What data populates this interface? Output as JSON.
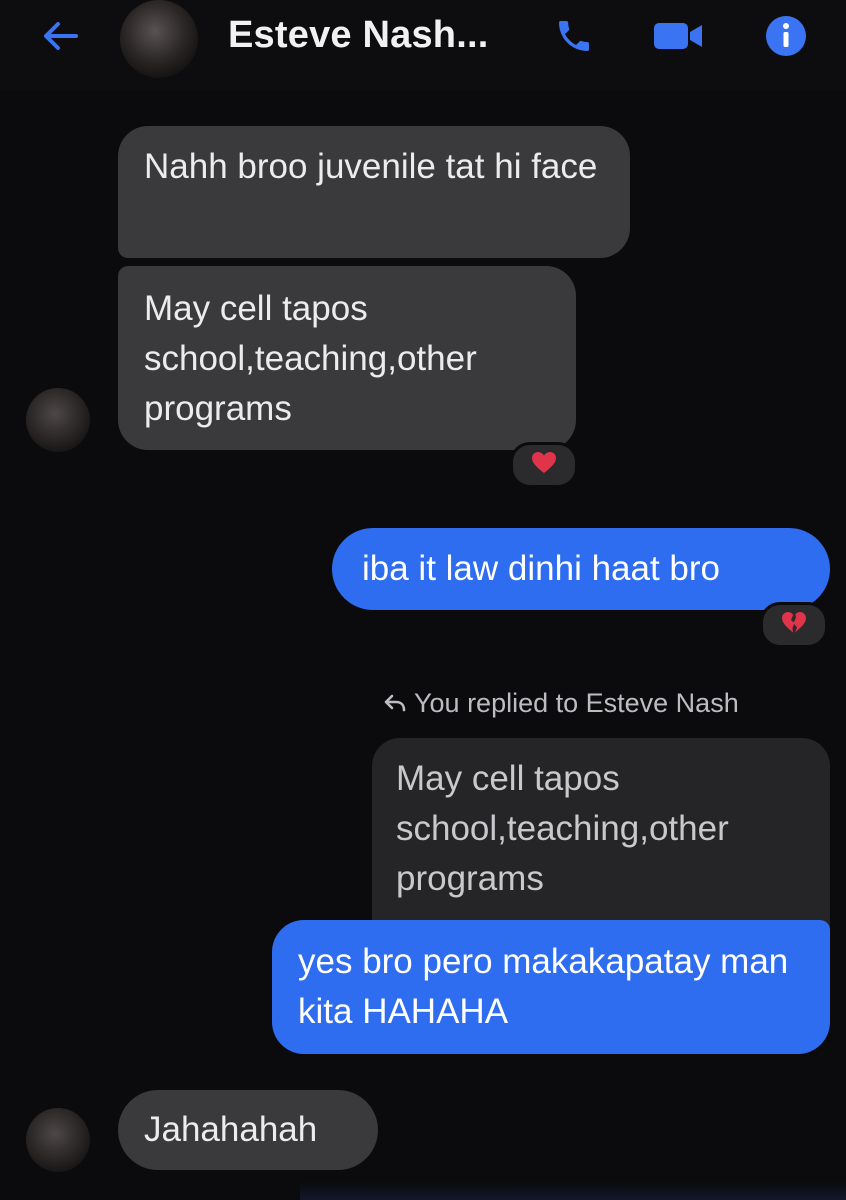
{
  "header": {
    "contact_name": "Esteve Nash...",
    "icons": {
      "back": "back-arrow-icon",
      "call": "phone-icon",
      "video": "video-camera-icon",
      "info": "info-icon"
    },
    "accent_color": "#2e6cf0"
  },
  "messages": [
    {
      "direction": "incoming",
      "text": "Nahh broo juvenile tat hi face"
    },
    {
      "direction": "incoming",
      "text": "May cell tapos school,teaching,other programs",
      "reaction": "heart"
    },
    {
      "direction": "outgoing",
      "text": "iba it law dinhi haat bro",
      "reaction": "broken-heart"
    },
    {
      "direction": "outgoing",
      "text": "yes bro pero makakapatay man kita HAHAHA",
      "reply_note": "You replied to Esteve Nash",
      "quoted_text": "May cell tapos school,teaching,other programs"
    },
    {
      "direction": "incoming",
      "text": "Jahahahah"
    }
  ],
  "colors": {
    "background": "#0b0b0d",
    "incoming_bubble": "#3a3a3c",
    "outgoing_bubble": "#2e6cf0",
    "quoted_bubble": "#252527",
    "reaction_heart": "#e0344a"
  }
}
